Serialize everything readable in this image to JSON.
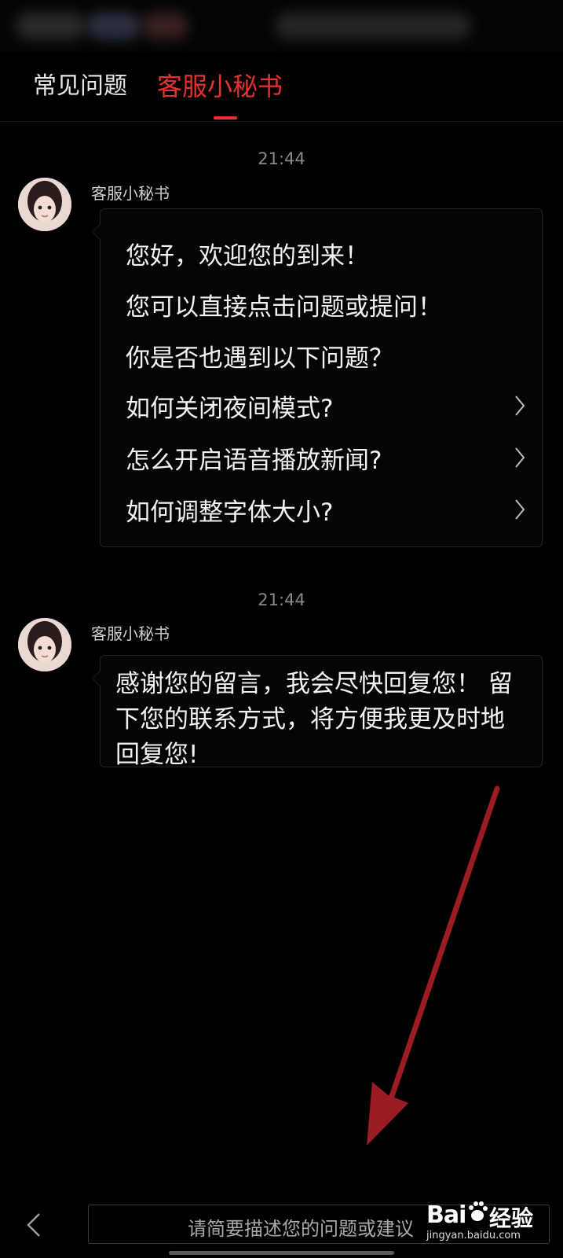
{
  "tabs": {
    "faq": "常见问题",
    "assistant": "客服小秘书"
  },
  "messages": [
    {
      "time": "21:44",
      "sender": "客服小秘书",
      "lines": [
        "您好，欢迎您的到来！",
        "您可以直接点击问题或提问！",
        "你是否也遇到以下问题？"
      ],
      "faq_items": [
        "如何关闭夜间模式?",
        "怎么开启语音播放新闻?",
        "如何调整字体大小?"
      ]
    },
    {
      "time": "21:44",
      "sender": "客服小秘书",
      "text": "感谢您的留言，我会尽快回复您！ 留下您的联系方式，将方便我更及时地回复您!"
    }
  ],
  "input": {
    "placeholder": "请简要描述您的问题或建议"
  },
  "watermark": {
    "logo": "Bai",
    "word": "经验",
    "url": "jingyan.baidu.com"
  },
  "colors": {
    "accent": "#e8312f",
    "arrow": "#9b1c22",
    "background": "#000000"
  },
  "icons": {
    "chevron": "chevron-right-icon",
    "back": "chevron-left-icon"
  }
}
